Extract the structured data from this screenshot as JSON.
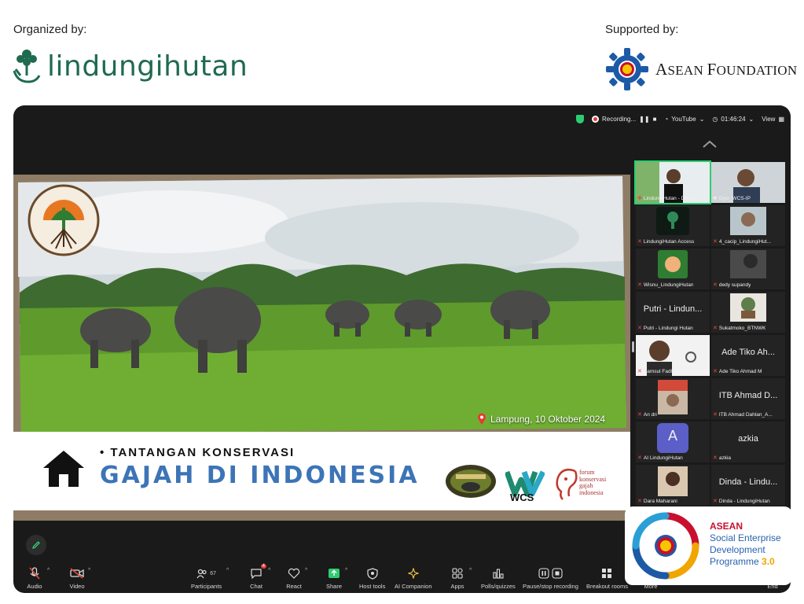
{
  "header": {
    "organized_label": "Organized by:",
    "supported_label": "Supported by:",
    "organizer_name": "lindungihutan",
    "supporter_name_first": "A",
    "supporter_name_rest": "SEAN ",
    "supporter_name_first2": "F",
    "supporter_name_rest2": "OUNDATION"
  },
  "status_bar": {
    "recording": "Recording...",
    "stream": "YouTube",
    "timer": "01:46:24",
    "view": "View"
  },
  "slide": {
    "location": "Lampung, 10 Oktober 2024",
    "subtitle": "• TANTANGAN KONSERVASI",
    "title": "GAJAH DI INDONESIA",
    "partner_wcs": "WCS",
    "partner_forum": [
      "forum",
      "konservasi",
      "gajah",
      "indonesia"
    ]
  },
  "gallery": {
    "tiles": [
      {
        "name": "LindungiHutan - Dara..."
      },
      {
        "name": "Giyo_WCS-IP"
      },
      {
        "name": "LindungiHutan Access"
      },
      {
        "name": "4_cacip_LindungiHut..."
      },
      {
        "name": "Wisnu_LindungiHutan"
      },
      {
        "name": "dedy supandy"
      },
      {
        "name": "Putri - Lindungi Hutan",
        "big": "Putri - Lindun..."
      },
      {
        "name": "Sukatmoko_BTNWK"
      },
      {
        "name": "Samsul Fadli"
      },
      {
        "name": "Ade Tiko Ahmad M",
        "big": "Ade Tiko Ah..."
      },
      {
        "name": "An dri"
      },
      {
        "name": "ITB Ahmad Dahlan_A...",
        "big": "ITB Ahmad D..."
      },
      {
        "name": "AI LindungiHutan",
        "avatar": "A"
      },
      {
        "name": "azkia",
        "big": "azkia"
      },
      {
        "name": "Dara Maharani"
      },
      {
        "name": "Dinda - LindungiHutan",
        "big": "Dinda - Lindu..."
      }
    ]
  },
  "sep": {
    "line1": "ASEAN",
    "line2": "Social Enterprise",
    "line3": "Development",
    "line4": "Programme",
    "version": "3.0"
  },
  "toolbar": {
    "audio": "Audio",
    "video": "Video",
    "participants": "Participants",
    "participants_count": "67",
    "chat": "Chat",
    "chat_badge": "4",
    "react": "React",
    "share": "Share",
    "host_tools": "Host tools",
    "ai_companion": "AI Companion",
    "apps": "Apps",
    "polls": "Polls/quizzes",
    "pause_stop": "Pause/stop recording",
    "breakout": "Breakout rooms",
    "more": "More",
    "end": "End"
  },
  "colors": {
    "brand_green": "#1f6b4f",
    "asean_blue": "#1d5aa6",
    "zoom_bg": "#1a1a1a",
    "active_speaker": "#2ecc71",
    "title_blue": "#3d74b7"
  }
}
